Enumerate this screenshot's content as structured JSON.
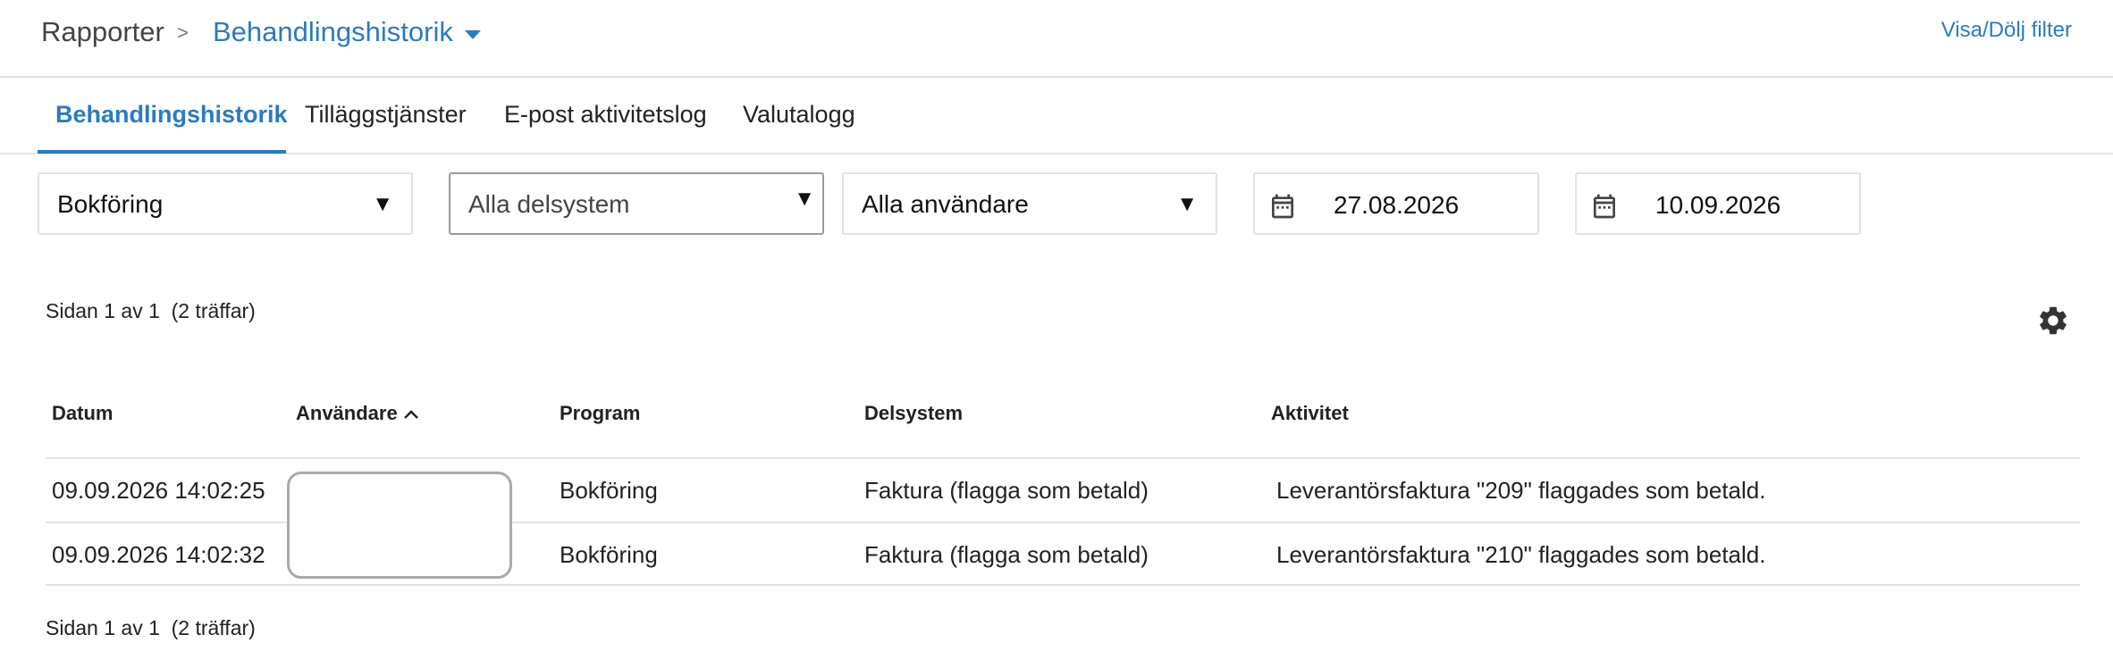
{
  "breadcrumb": {
    "root": "Rapporter",
    "separator": ">",
    "current": "Behandlingshistorik"
  },
  "header": {
    "filter_toggle": "Visa/Dölj filter"
  },
  "tabs": [
    {
      "label": "Behandlingshistorik",
      "active": true
    },
    {
      "label": "Tilläggstjänster",
      "active": false
    },
    {
      "label": "E-post aktivitetslog",
      "active": false
    },
    {
      "label": "Valutalogg",
      "active": false
    }
  ],
  "filters": {
    "program": {
      "value": "Bokföring"
    },
    "subsystem": {
      "value": "Alla delsystem"
    },
    "user": {
      "value": "Alla användare"
    },
    "date_from": {
      "value": "27.08.2026"
    },
    "date_to": {
      "value": "10.09.2026"
    }
  },
  "pager": {
    "top": "Sidan 1 av 1  (2 träffar)",
    "bottom": "Sidan 1 av 1  (2 träffar)"
  },
  "icons": {
    "settings": "gear-icon",
    "calendar": "calendar-icon",
    "dropdown": "triangle-down-icon",
    "sort": "chevron-up-icon"
  },
  "colors": {
    "accent": "#2a7bc0",
    "border": "#e4e4e4"
  },
  "table": {
    "columns": [
      "Datum",
      "Användare",
      "Program",
      "Delsystem",
      "Aktivitet"
    ],
    "sorted_column": "Användare",
    "rows": [
      {
        "datum": "09.09.2026 14:02:25",
        "anvandare": "",
        "program": "Bokföring",
        "delsystem": "Faktura (flagga som betald)",
        "aktivitet": "Leverantörsfaktura \"209\" flaggades som betald."
      },
      {
        "datum": "09.09.2026 14:02:32",
        "anvandare": "",
        "program": "Bokföring",
        "delsystem": "Faktura (flagga som betald)",
        "aktivitet": "Leverantörsfaktura \"210\" flaggades som betald."
      }
    ]
  }
}
